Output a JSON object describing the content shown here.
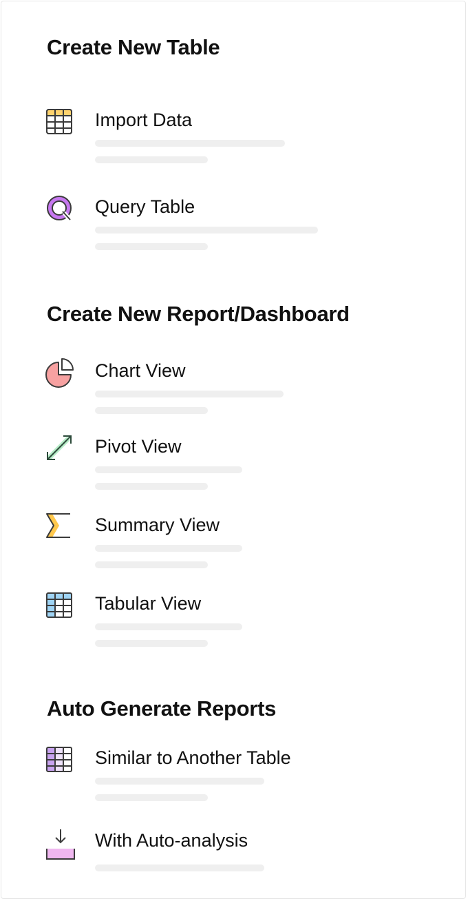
{
  "sections": [
    {
      "title": "Create New Table",
      "items": [
        {
          "label": "Import Data",
          "icon": "import-data-icon"
        },
        {
          "label": "Query Table",
          "icon": "query-table-icon"
        }
      ]
    },
    {
      "title": "Create New Report/Dashboard",
      "items": [
        {
          "label": "Chart View",
          "icon": "chart-view-icon"
        },
        {
          "label": "Pivot View",
          "icon": "pivot-view-icon"
        },
        {
          "label": "Summary View",
          "icon": "summary-view-icon"
        },
        {
          "label": "Tabular View",
          "icon": "tabular-view-icon"
        }
      ]
    },
    {
      "title": "Auto Generate Reports",
      "items": [
        {
          "label": "Similar to Another Table",
          "icon": "similar-table-icon"
        },
        {
          "label": "With Auto-analysis",
          "icon": "auto-analysis-icon"
        }
      ]
    }
  ],
  "colors": {
    "import_data": "#ffd36e",
    "query_table": "#c778f0",
    "chart_view": "#f7a1a1",
    "pivot_view": "#2e9a5e",
    "summary_view": "#ffc84d",
    "tabular_view": "#9fd4f5",
    "similar_table": "#c8a3f0",
    "auto_analysis": "#f0b7f0",
    "placeholder_bar": "#efefef"
  }
}
